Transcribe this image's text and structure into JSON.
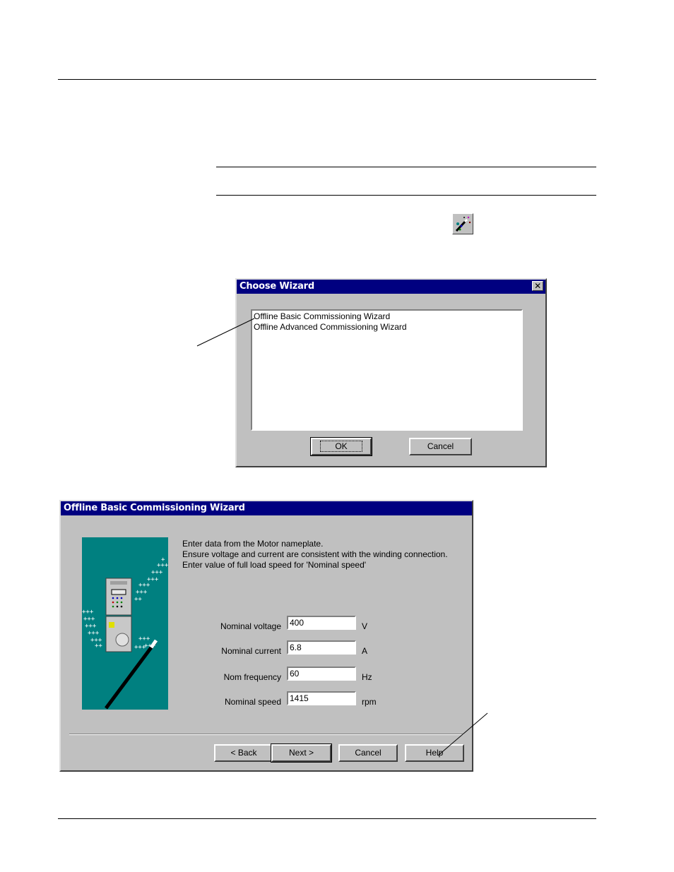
{
  "choose_wizard": {
    "title": "Choose Wizard",
    "close_glyph": "✕",
    "options": [
      "Offline Basic Commissioning Wizard",
      "Offline Advanced Commissioning Wizard"
    ],
    "ok_label": "OK",
    "cancel_label": "Cancel"
  },
  "basic_wizard": {
    "title": "Offline Basic Commissioning Wizard",
    "instructions": [
      "Enter data from the Motor nameplate.",
      "Ensure voltage and current are consistent with the winding connection.",
      "Enter value of full load speed for 'Nominal speed'"
    ],
    "fields": [
      {
        "label": "Nominal voltage",
        "value": "400",
        "unit": "V"
      },
      {
        "label": "Nominal current",
        "value": "6.8",
        "unit": "A"
      },
      {
        "label": "Nom frequency",
        "value": "60",
        "unit": "Hz"
      },
      {
        "label": "Nominal speed",
        "value": "1415",
        "unit": "rpm"
      }
    ],
    "buttons": {
      "back": "< Back",
      "next": "Next >",
      "cancel": "Cancel",
      "help": "Help"
    }
  },
  "icons": {
    "toolbar": "wizard-icon",
    "illustration": "drive-with-magic-wand-icon"
  },
  "colors": {
    "titlebar": "#000080",
    "window_face": "#c0c0c0",
    "illustration_bg": "#008080"
  }
}
